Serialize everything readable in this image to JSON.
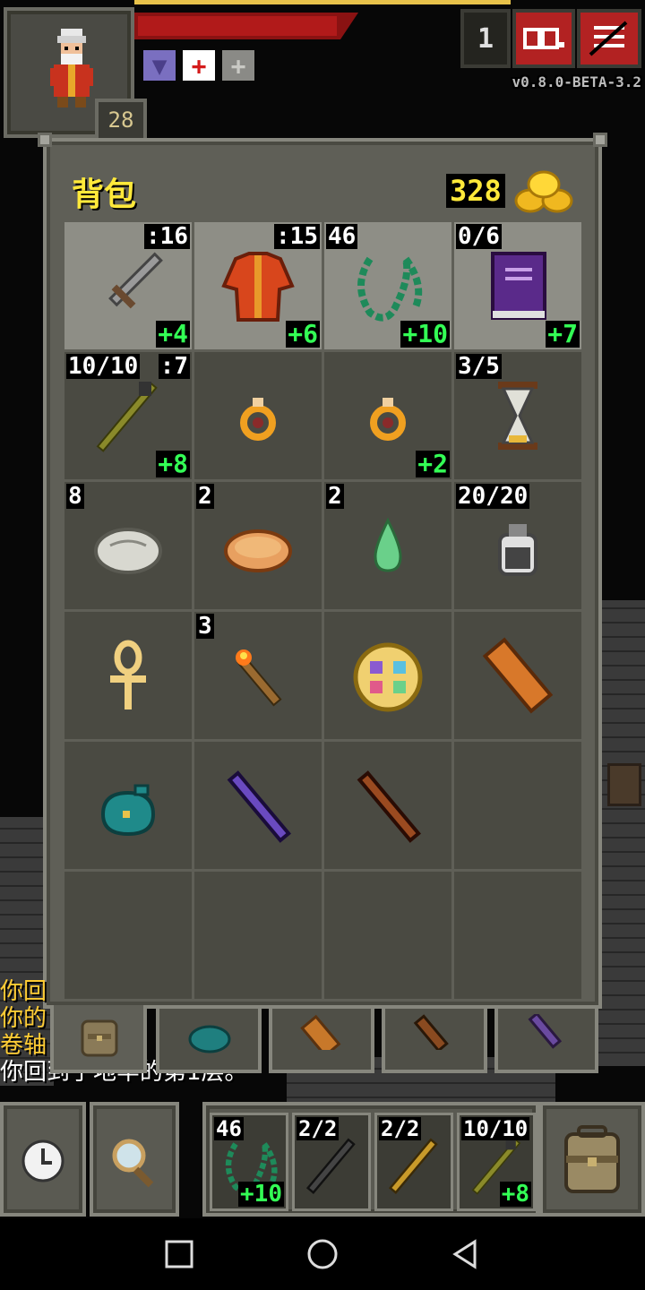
{
  "hud": {
    "hero_level": "28",
    "depth": "1",
    "version": "v0.8.0-BETA-3.2",
    "buff_icons": [
      "mind-vision-buff-icon",
      "healing-buff-icon",
      "bless-buff-icon"
    ]
  },
  "bag": {
    "title": "背包",
    "gold": "328",
    "slots": [
      {
        "item": "sword",
        "tl": "",
        "tr": ":16",
        "br": "+4",
        "equipped": true
      },
      {
        "item": "robe",
        "tl": "",
        "tr": ":15",
        "br": "+6",
        "equipped": true
      },
      {
        "item": "chain-necklace",
        "tl": "46",
        "tr": "",
        "br": "+10",
        "equipped": true
      },
      {
        "item": "spellbook",
        "tl": "0/6",
        "tr": "",
        "br": "+7",
        "equipped": true
      },
      {
        "item": "staff",
        "tl": "10/10",
        "tr": ":7",
        "br": "+8",
        "equipped": false
      },
      {
        "item": "ring",
        "tl": "",
        "tr": "",
        "br": "",
        "equipped": false
      },
      {
        "item": "ring",
        "tl": "",
        "tr": "",
        "br": "+2",
        "equipped": false
      },
      {
        "item": "hourglass",
        "tl": "3/5",
        "tr": "",
        "br": "",
        "equipped": false
      },
      {
        "item": "stone",
        "tl": "8",
        "tr": "",
        "br": "",
        "equipped": false
      },
      {
        "item": "meat-pie",
        "tl": "2",
        "tr": "",
        "br": "",
        "equipped": false
      },
      {
        "item": "seed",
        "tl": "2",
        "tr": "",
        "br": "",
        "equipped": false
      },
      {
        "item": "dew-vial",
        "tl": "20/20",
        "tr": "",
        "br": "",
        "equipped": false
      },
      {
        "item": "ankh",
        "tl": "",
        "tr": "",
        "br": "",
        "equipped": false
      },
      {
        "item": "torch",
        "tl": "3",
        "tr": "",
        "br": "",
        "equipped": false
      },
      {
        "item": "alchemy-wheel",
        "tl": "",
        "tr": "",
        "br": "",
        "equipped": false
      },
      {
        "item": "scroll-holder",
        "tl": "",
        "tr": "",
        "br": "",
        "equipped": false
      },
      {
        "item": "pouch",
        "tl": "",
        "tr": "",
        "br": "",
        "equipped": false
      },
      {
        "item": "wand-purple",
        "tl": "",
        "tr": "",
        "br": "",
        "equipped": false
      },
      {
        "item": "wand-wood",
        "tl": "",
        "tr": "",
        "br": "",
        "equipped": false
      },
      {
        "item": "empty",
        "tl": "",
        "tr": "",
        "br": "",
        "equipped": false
      },
      {
        "item": "empty",
        "tl": "",
        "tr": "",
        "br": "",
        "equipped": false
      },
      {
        "item": "empty",
        "tl": "",
        "tr": "",
        "br": "",
        "equipped": false
      },
      {
        "item": "empty",
        "tl": "",
        "tr": "",
        "br": "",
        "equipped": false
      },
      {
        "item": "empty",
        "tl": "",
        "tr": "",
        "br": "",
        "equipped": false
      }
    ]
  },
  "log": {
    "lines": [
      "你回",
      "你的",
      "卷轴",
      "你回到了地牢的第1层。"
    ]
  },
  "quickslots": [
    {
      "item": "chain-necklace",
      "tl": "46",
      "br": "+10"
    },
    {
      "item": "wand-dark",
      "tl": "2/2",
      "br": ""
    },
    {
      "item": "wand-gold",
      "tl": "2/2",
      "br": ""
    },
    {
      "item": "staff",
      "tl": "10/10",
      "br": "+8"
    }
  ],
  "colors": {
    "gold_text": "#ffe93a",
    "upgrade_text": "#33ff55",
    "hp": "#b11a1a",
    "log_text": "#ffcc33"
  }
}
